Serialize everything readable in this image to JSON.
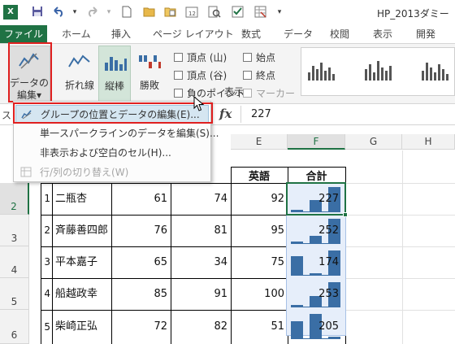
{
  "titlebar": {
    "app_logo": "X",
    "doc_title": "HP_2013ダミー",
    "icons": [
      "excel-logo-icon",
      "save-icon",
      "undo-icon",
      "undo-dropdown-icon",
      "redo-icon",
      "redo-dropdown-icon",
      "new-document-icon",
      "open-folder-icon",
      "open-file-icon",
      "calendar-icon",
      "print-preview-icon",
      "checkbox-icon",
      "spreadsheet-icon"
    ]
  },
  "tabs": [
    "ファイル",
    "ホーム",
    "挿入",
    "ページ レイアウト",
    "数式",
    "データ",
    "校閲",
    "表示",
    "開発"
  ],
  "ribbon": {
    "data_button": {
      "line1": "データの",
      "line2": "編集",
      "arrow": "▾"
    },
    "types": [
      {
        "label": "折れ線",
        "icon": "line-sparkline-icon"
      },
      {
        "label": "縦棒",
        "icon": "column-sparkline-icon"
      },
      {
        "label": "勝敗",
        "icon": "win-loss-sparkline-icon"
      }
    ],
    "show_checks": [
      {
        "label": "頂点 (山)",
        "checked": false
      },
      {
        "label": "頂点 (谷)",
        "checked": false
      },
      {
        "label": "負のポイント",
        "checked": false
      },
      {
        "label": "始点",
        "checked": false
      },
      {
        "label": "終点",
        "checked": false
      },
      {
        "label": "マーカー",
        "checked": false,
        "disabled": true
      }
    ],
    "group_labels": {
      "left": "ス",
      "show": "表示"
    }
  },
  "formula_bar": {
    "fx": "fx",
    "value": "227"
  },
  "menu": {
    "items": [
      {
        "label": "グループの位置とデータの編集(E)...",
        "highlighted": true,
        "icon": "edit-group-data-icon"
      },
      {
        "label": "単一スパークラインのデータを編集(S)...",
        "highlighted": false
      },
      {
        "label": "非表示および空白のセル(H)...",
        "highlighted": false
      },
      {
        "label": "行/列の切り替え(W)",
        "disabled": true,
        "icon": "switch-row-column-icon"
      }
    ]
  },
  "grid": {
    "columns": [
      "E",
      "F",
      "G",
      "H"
    ],
    "selected_column": "F",
    "rows": [
      "2",
      "3",
      "4",
      "5",
      "6"
    ],
    "selected_row": "2",
    "header_row": {
      "e": "英語",
      "f": "合計"
    },
    "data": [
      {
        "no": "1",
        "name": "二瓶杏",
        "c": "61",
        "d": "74",
        "e": "92",
        "total": "227"
      },
      {
        "no": "2",
        "name": "斉藤善四郎",
        "c": "76",
        "d": "81",
        "e": "95",
        "total": "252"
      },
      {
        "no": "3",
        "name": "平本嘉子",
        "c": "65",
        "d": "34",
        "e": "75",
        "total": "174"
      },
      {
        "no": "4",
        "name": "船越政幸",
        "c": "85",
        "d": "91",
        "e": "100",
        "total": "253"
      },
      {
        "no": "5",
        "name": "柴崎正弘",
        "c": "72",
        "d": "82",
        "e": "51",
        "total": "205"
      }
    ],
    "spark_color": "#3a6ea5",
    "selection_color": "#1f7244"
  },
  "colors": {
    "excel_green": "#1f7244",
    "highlight": "#d5e6f1",
    "callout_red": "#e02020"
  }
}
